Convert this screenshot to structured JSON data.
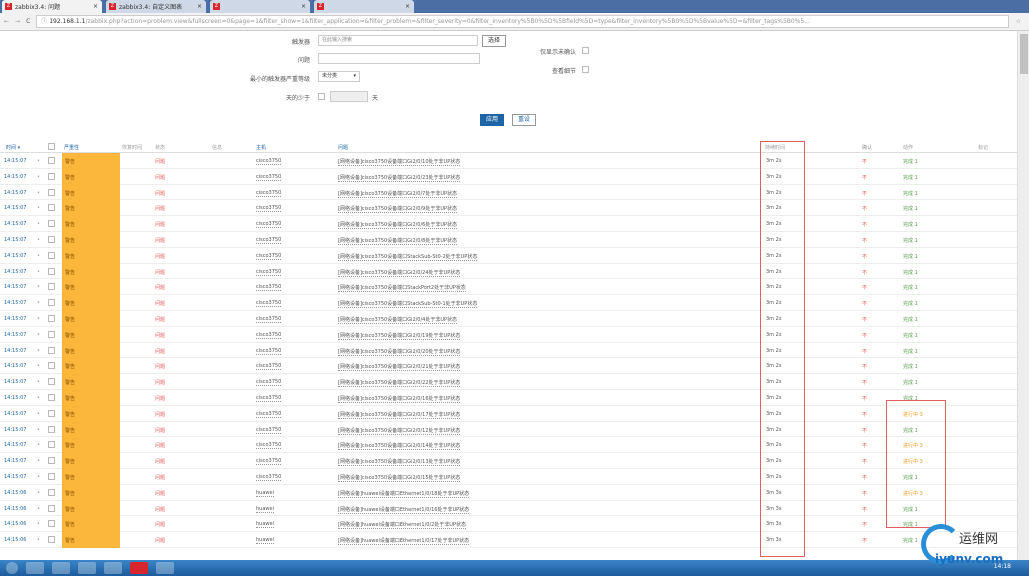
{
  "browser": {
    "tabs": [
      {
        "label": "zabbix3.4: 问题",
        "active": true
      },
      {
        "label": "zabbix3.4: 自定义图表",
        "active": false
      },
      {
        "label": "",
        "active": false
      },
      {
        "label": "",
        "active": false
      }
    ],
    "url_host": "192.168.1.1",
    "url_rest": "/zabbix.php?action=problem.view&fullscreen=0&page=1&filter_show=1&filter_application=&filter_problem=&filter_severity=0&filter_inventory%5B0%5D%5Bfield%5D=type&filter_inventory%5B0%5D%5Bvalue%5D=&filter_tags%5B0%5..."
  },
  "filter": {
    "trigger_label": "触发器",
    "trigger_placeholder": "在此输入搜索",
    "select_button": "选择",
    "problem_label": "问题",
    "problem_value": "",
    "min_severity_label": "最小的触发器严重等级",
    "min_severity_value": "未分类",
    "age_label": "天的少于",
    "age_unit": "天",
    "unack_label": "仅显示未确认",
    "details_label": "查看细节",
    "apply_button": "应用",
    "reset_button": "重设"
  },
  "table": {
    "headers": {
      "time": "时间 ▾",
      "severity": "严重性",
      "recovery": "恢复时间",
      "status": "状态",
      "info": "信息",
      "host": "主机",
      "problem": "问题",
      "duration": "持续时间",
      "ack": "确认",
      "actions": "动作",
      "tags": "标记"
    },
    "rows": [
      {
        "time": "14:15:07",
        "severity": "警告",
        "status": "问题",
        "host": "cisco3750",
        "problem": "[网络设备]cisco3750设备端口Gi2/0/10处于非UP状态",
        "duration": "3m 2s",
        "ack": "不",
        "action": "完成 1",
        "action_state": "done"
      },
      {
        "time": "14:15:07",
        "severity": "警告",
        "status": "问题",
        "host": "cisco3750",
        "problem": "[网络设备]cisco3750设备端口Gi2/0/23处于非UP状态",
        "duration": "3m 2s",
        "ack": "不",
        "action": "完成 1",
        "action_state": "done"
      },
      {
        "time": "14:15:07",
        "severity": "警告",
        "status": "问题",
        "host": "cisco3750",
        "problem": "[网络设备]cisco3750设备端口Gi2/0/7处于非UP状态",
        "duration": "3m 2s",
        "ack": "不",
        "action": "完成 1",
        "action_state": "done"
      },
      {
        "time": "14:15:07",
        "severity": "警告",
        "status": "问题",
        "host": "cisco3750",
        "problem": "[网络设备]cisco3750设备端口Gi2/0/9处于非UP状态",
        "duration": "3m 2s",
        "ack": "不",
        "action": "完成 1",
        "action_state": "done"
      },
      {
        "time": "14:15:07",
        "severity": "警告",
        "status": "问题",
        "host": "cisco3750",
        "problem": "[网络设备]cisco3750设备端口Gi2/0/6处于非UP状态",
        "duration": "3m 2s",
        "ack": "不",
        "action": "完成 1",
        "action_state": "done"
      },
      {
        "time": "14:15:07",
        "severity": "警告",
        "status": "问题",
        "host": "cisco3750",
        "problem": "[网络设备]cisco3750设备端口Gi2/0/8处于非UP状态",
        "duration": "3m 2s",
        "ack": "不",
        "action": "完成 1",
        "action_state": "done"
      },
      {
        "time": "14:15:07",
        "severity": "警告",
        "status": "问题",
        "host": "cisco3750",
        "problem": "[网络设备]cisco3750设备端口StackSub-St0-2处于非UP状态",
        "duration": "3m 2s",
        "ack": "不",
        "action": "完成 1",
        "action_state": "done"
      },
      {
        "time": "14:15:07",
        "severity": "警告",
        "status": "问题",
        "host": "cisco3750",
        "problem": "[网络设备]cisco3750设备端口Gi2/0/24处于非UP状态",
        "duration": "3m 2s",
        "ack": "不",
        "action": "完成 1",
        "action_state": "done"
      },
      {
        "time": "14:15:07",
        "severity": "警告",
        "status": "问题",
        "host": "cisco3750",
        "problem": "[网络设备]cisco3750设备端口StackPort2处于非UP状态",
        "duration": "3m 2s",
        "ack": "不",
        "action": "完成 1",
        "action_state": "done"
      },
      {
        "time": "14:15:07",
        "severity": "警告",
        "status": "问题",
        "host": "cisco3750",
        "problem": "[网络设备]cisco3750设备端口StackSub-St0-1处于非UP状态",
        "duration": "3m 2s",
        "ack": "不",
        "action": "完成 1",
        "action_state": "done"
      },
      {
        "time": "14:15:07",
        "severity": "警告",
        "status": "问题",
        "host": "cisco3750",
        "problem": "[网络设备]cisco3750设备端口Gi2/0/4处于非UP状态",
        "duration": "3m 2s",
        "ack": "不",
        "action": "完成 1",
        "action_state": "done"
      },
      {
        "time": "14:15:07",
        "severity": "警告",
        "status": "问题",
        "host": "cisco3750",
        "problem": "[网络设备]cisco3750设备端口Gi2/0/19处于非UP状态",
        "duration": "3m 2s",
        "ack": "不",
        "action": "完成 1",
        "action_state": "done"
      },
      {
        "time": "14:15:07",
        "severity": "警告",
        "status": "问题",
        "host": "cisco3750",
        "problem": "[网络设备]cisco3750设备端口Gi2/0/20处于非UP状态",
        "duration": "3m 2s",
        "ack": "不",
        "action": "完成 1",
        "action_state": "done"
      },
      {
        "time": "14:15:07",
        "severity": "警告",
        "status": "问题",
        "host": "cisco3750",
        "problem": "[网络设备]cisco3750设备端口Gi2/0/21处于非UP状态",
        "duration": "3m 2s",
        "ack": "不",
        "action": "完成 1",
        "action_state": "done"
      },
      {
        "time": "14:15:07",
        "severity": "警告",
        "status": "问题",
        "host": "cisco3750",
        "problem": "[网络设备]cisco3750设备端口Gi2/0/22处于非UP状态",
        "duration": "3m 2s",
        "ack": "不",
        "action": "完成 1",
        "action_state": "done"
      },
      {
        "time": "14:15:07",
        "severity": "警告",
        "status": "问题",
        "host": "cisco3750",
        "problem": "[网络设备]cisco3750设备端口Gi2/0/16处于非UP状态",
        "duration": "3m 2s",
        "ack": "不",
        "action": "完成 1",
        "action_state": "done"
      },
      {
        "time": "14:15:07",
        "severity": "警告",
        "status": "问题",
        "host": "cisco3750",
        "problem": "[网络设备]cisco3750设备端口Gi2/0/17处于非UP状态",
        "duration": "3m 2s",
        "ack": "不",
        "action": "进行中 3",
        "action_state": "progress"
      },
      {
        "time": "14:15:07",
        "severity": "警告",
        "status": "问题",
        "host": "cisco3750",
        "problem": "[网络设备]cisco3750设备端口Gi2/0/12处于非UP状态",
        "duration": "3m 2s",
        "ack": "不",
        "action": "完成 1",
        "action_state": "done"
      },
      {
        "time": "14:15:07",
        "severity": "警告",
        "status": "问题",
        "host": "cisco3750",
        "problem": "[网络设备]cisco3750设备端口Gi2/0/14处于非UP状态",
        "duration": "3m 2s",
        "ack": "不",
        "action": "进行中 3",
        "action_state": "progress"
      },
      {
        "time": "14:15:07",
        "severity": "警告",
        "status": "问题",
        "host": "cisco3750",
        "problem": "[网络设备]cisco3750设备端口Gi2/0/13处于非UP状态",
        "duration": "3m 2s",
        "ack": "不",
        "action": "进行中 3",
        "action_state": "progress"
      },
      {
        "time": "14:15:07",
        "severity": "警告",
        "status": "问题",
        "host": "cisco3750",
        "problem": "[网络设备]cisco3750设备端口Gi2/0/15处于非UP状态",
        "duration": "3m 2s",
        "ack": "不",
        "action": "完成 1",
        "action_state": "done"
      },
      {
        "time": "14:15:06",
        "severity": "警告",
        "status": "问题",
        "host": "huawei",
        "problem": "[网络设备]huawei设备端口Ethernet1/0/18处于非UP状态",
        "duration": "3m 3s",
        "ack": "不",
        "action": "进行中 3",
        "action_state": "progress"
      },
      {
        "time": "14:15:06",
        "severity": "警告",
        "status": "问题",
        "host": "huawei",
        "problem": "[网络设备]huawei设备端口Ethernet1/0/16处于非UP状态",
        "duration": "3m 3s",
        "ack": "不",
        "action": "完成 1",
        "action_state": "done"
      },
      {
        "time": "14:15:06",
        "severity": "警告",
        "status": "问题",
        "host": "huawei",
        "problem": "[网络设备]huawei设备端口Ethernet1/0/2处于非UP状态",
        "duration": "3m 3s",
        "ack": "不",
        "action": "完成 1",
        "action_state": "done"
      },
      {
        "time": "14:15:06",
        "severity": "警告",
        "status": "问题",
        "host": "huawei",
        "problem": "[网络设备]huawei设备端口Ethernet1/0/17处于非UP状态",
        "duration": "3m 3s",
        "ack": "不",
        "action": "完成 1",
        "action_state": "done"
      }
    ]
  },
  "colors": {
    "severity_warning": "#fbb63c",
    "status_problem": "#e45959",
    "action_done": "#59a14f",
    "action_progress": "#f29b1d",
    "link": "#1f65a6"
  },
  "taskbar": {
    "clock": "14:18"
  },
  "watermark": {
    "text": "运维网",
    "domain": "iyunv.com"
  }
}
